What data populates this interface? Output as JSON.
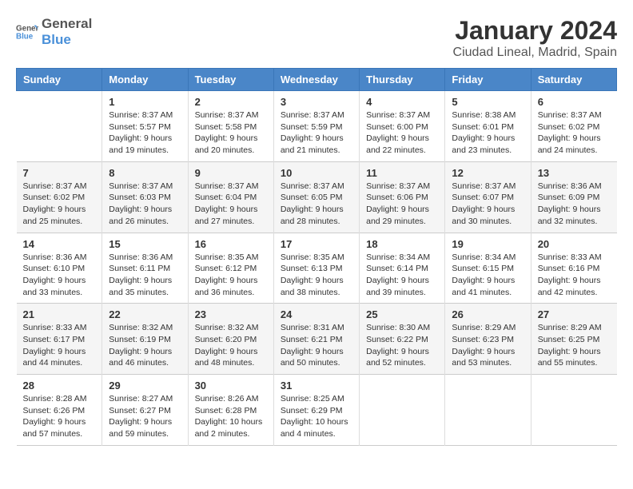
{
  "logo": {
    "line1": "General",
    "line2": "Blue"
  },
  "title": "January 2024",
  "subtitle": "Ciudad Lineal, Madrid, Spain",
  "days_of_week": [
    "Sunday",
    "Monday",
    "Tuesday",
    "Wednesday",
    "Thursday",
    "Friday",
    "Saturday"
  ],
  "weeks": [
    [
      {
        "day": "",
        "sunrise": "",
        "sunset": "",
        "daylight": ""
      },
      {
        "day": "1",
        "sunrise": "Sunrise: 8:37 AM",
        "sunset": "Sunset: 5:57 PM",
        "daylight": "Daylight: 9 hours and 19 minutes."
      },
      {
        "day": "2",
        "sunrise": "Sunrise: 8:37 AM",
        "sunset": "Sunset: 5:58 PM",
        "daylight": "Daylight: 9 hours and 20 minutes."
      },
      {
        "day": "3",
        "sunrise": "Sunrise: 8:37 AM",
        "sunset": "Sunset: 5:59 PM",
        "daylight": "Daylight: 9 hours and 21 minutes."
      },
      {
        "day": "4",
        "sunrise": "Sunrise: 8:37 AM",
        "sunset": "Sunset: 6:00 PM",
        "daylight": "Daylight: 9 hours and 22 minutes."
      },
      {
        "day": "5",
        "sunrise": "Sunrise: 8:38 AM",
        "sunset": "Sunset: 6:01 PM",
        "daylight": "Daylight: 9 hours and 23 minutes."
      },
      {
        "day": "6",
        "sunrise": "Sunrise: 8:37 AM",
        "sunset": "Sunset: 6:02 PM",
        "daylight": "Daylight: 9 hours and 24 minutes."
      }
    ],
    [
      {
        "day": "7",
        "sunrise": "Sunrise: 8:37 AM",
        "sunset": "Sunset: 6:02 PM",
        "daylight": "Daylight: 9 hours and 25 minutes."
      },
      {
        "day": "8",
        "sunrise": "Sunrise: 8:37 AM",
        "sunset": "Sunset: 6:03 PM",
        "daylight": "Daylight: 9 hours and 26 minutes."
      },
      {
        "day": "9",
        "sunrise": "Sunrise: 8:37 AM",
        "sunset": "Sunset: 6:04 PM",
        "daylight": "Daylight: 9 hours and 27 minutes."
      },
      {
        "day": "10",
        "sunrise": "Sunrise: 8:37 AM",
        "sunset": "Sunset: 6:05 PM",
        "daylight": "Daylight: 9 hours and 28 minutes."
      },
      {
        "day": "11",
        "sunrise": "Sunrise: 8:37 AM",
        "sunset": "Sunset: 6:06 PM",
        "daylight": "Daylight: 9 hours and 29 minutes."
      },
      {
        "day": "12",
        "sunrise": "Sunrise: 8:37 AM",
        "sunset": "Sunset: 6:07 PM",
        "daylight": "Daylight: 9 hours and 30 minutes."
      },
      {
        "day": "13",
        "sunrise": "Sunrise: 8:36 AM",
        "sunset": "Sunset: 6:09 PM",
        "daylight": "Daylight: 9 hours and 32 minutes."
      }
    ],
    [
      {
        "day": "14",
        "sunrise": "Sunrise: 8:36 AM",
        "sunset": "Sunset: 6:10 PM",
        "daylight": "Daylight: 9 hours and 33 minutes."
      },
      {
        "day": "15",
        "sunrise": "Sunrise: 8:36 AM",
        "sunset": "Sunset: 6:11 PM",
        "daylight": "Daylight: 9 hours and 35 minutes."
      },
      {
        "day": "16",
        "sunrise": "Sunrise: 8:35 AM",
        "sunset": "Sunset: 6:12 PM",
        "daylight": "Daylight: 9 hours and 36 minutes."
      },
      {
        "day": "17",
        "sunrise": "Sunrise: 8:35 AM",
        "sunset": "Sunset: 6:13 PM",
        "daylight": "Daylight: 9 hours and 38 minutes."
      },
      {
        "day": "18",
        "sunrise": "Sunrise: 8:34 AM",
        "sunset": "Sunset: 6:14 PM",
        "daylight": "Daylight: 9 hours and 39 minutes."
      },
      {
        "day": "19",
        "sunrise": "Sunrise: 8:34 AM",
        "sunset": "Sunset: 6:15 PM",
        "daylight": "Daylight: 9 hours and 41 minutes."
      },
      {
        "day": "20",
        "sunrise": "Sunrise: 8:33 AM",
        "sunset": "Sunset: 6:16 PM",
        "daylight": "Daylight: 9 hours and 42 minutes."
      }
    ],
    [
      {
        "day": "21",
        "sunrise": "Sunrise: 8:33 AM",
        "sunset": "Sunset: 6:17 PM",
        "daylight": "Daylight: 9 hours and 44 minutes."
      },
      {
        "day": "22",
        "sunrise": "Sunrise: 8:32 AM",
        "sunset": "Sunset: 6:19 PM",
        "daylight": "Daylight: 9 hours and 46 minutes."
      },
      {
        "day": "23",
        "sunrise": "Sunrise: 8:32 AM",
        "sunset": "Sunset: 6:20 PM",
        "daylight": "Daylight: 9 hours and 48 minutes."
      },
      {
        "day": "24",
        "sunrise": "Sunrise: 8:31 AM",
        "sunset": "Sunset: 6:21 PM",
        "daylight": "Daylight: 9 hours and 50 minutes."
      },
      {
        "day": "25",
        "sunrise": "Sunrise: 8:30 AM",
        "sunset": "Sunset: 6:22 PM",
        "daylight": "Daylight: 9 hours and 52 minutes."
      },
      {
        "day": "26",
        "sunrise": "Sunrise: 8:29 AM",
        "sunset": "Sunset: 6:23 PM",
        "daylight": "Daylight: 9 hours and 53 minutes."
      },
      {
        "day": "27",
        "sunrise": "Sunrise: 8:29 AM",
        "sunset": "Sunset: 6:25 PM",
        "daylight": "Daylight: 9 hours and 55 minutes."
      }
    ],
    [
      {
        "day": "28",
        "sunrise": "Sunrise: 8:28 AM",
        "sunset": "Sunset: 6:26 PM",
        "daylight": "Daylight: 9 hours and 57 minutes."
      },
      {
        "day": "29",
        "sunrise": "Sunrise: 8:27 AM",
        "sunset": "Sunset: 6:27 PM",
        "daylight": "Daylight: 9 hours and 59 minutes."
      },
      {
        "day": "30",
        "sunrise": "Sunrise: 8:26 AM",
        "sunset": "Sunset: 6:28 PM",
        "daylight": "Daylight: 10 hours and 2 minutes."
      },
      {
        "day": "31",
        "sunrise": "Sunrise: 8:25 AM",
        "sunset": "Sunset: 6:29 PM",
        "daylight": "Daylight: 10 hours and 4 minutes."
      },
      {
        "day": "",
        "sunrise": "",
        "sunset": "",
        "daylight": ""
      },
      {
        "day": "",
        "sunrise": "",
        "sunset": "",
        "daylight": ""
      },
      {
        "day": "",
        "sunrise": "",
        "sunset": "",
        "daylight": ""
      }
    ]
  ]
}
